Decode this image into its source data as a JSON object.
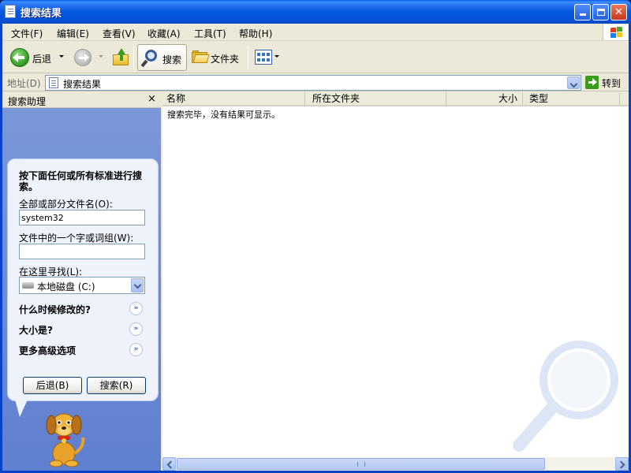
{
  "window": {
    "title": "搜索结果"
  },
  "menu": {
    "items": [
      "文件(F)",
      "编辑(E)",
      "查看(V)",
      "收藏(A)",
      "工具(T)",
      "帮助(H)"
    ]
  },
  "toolbar": {
    "back_label": "后退",
    "search_label": "搜索",
    "folders_label": "文件夹"
  },
  "address": {
    "label": "地址(D)",
    "value": "搜索结果",
    "go_label": "转到"
  },
  "search_pane": {
    "title": "搜索助理",
    "close": "×",
    "prompt": "按下面任何或所有标准进行搜索。",
    "filename_label": "全部或部分文件名(O):",
    "filename_value": "system32",
    "text_label": "文件中的一个字或词组(W):",
    "text_value": "",
    "lookin_label": "在这里寻找(L):",
    "lookin_value": "本地磁盘 (C:)",
    "expanders": [
      "什么时候修改的?",
      "大小是?",
      "更多高级选项"
    ],
    "expander_glyph": "»",
    "back_button": "后退(B)",
    "search_button": "搜索(R)"
  },
  "results": {
    "columns": [
      "名称",
      "所在文件夹",
      "大小",
      "类型"
    ],
    "empty_message": "搜索完毕，没有结果可显示。"
  },
  "colors": {
    "titlebar": "#0758e0",
    "frame": "#ece9d8",
    "pane": "#6b8ad2",
    "bubble": "#eef2fb"
  }
}
